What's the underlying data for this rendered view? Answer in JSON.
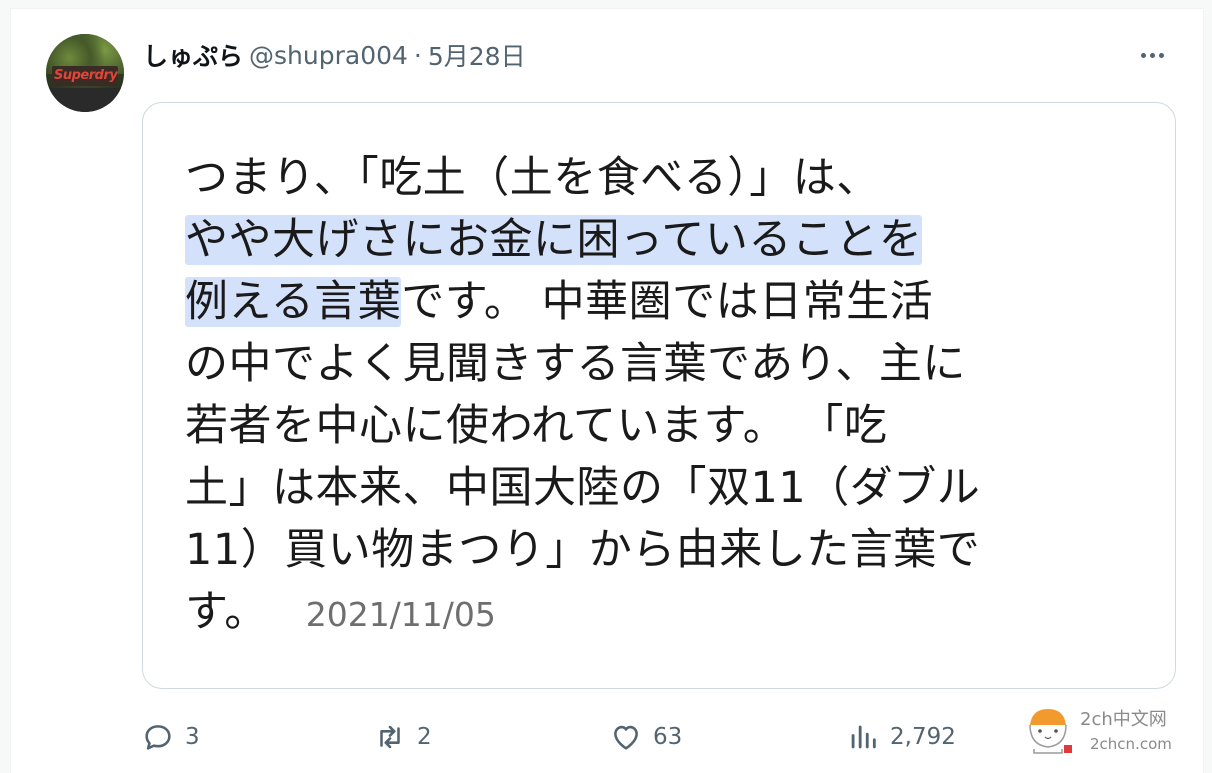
{
  "user": {
    "display_name": "しゅぷら",
    "handle": "@shupra004",
    "separator": "·",
    "date": "5月28日",
    "avatar_text": "Superdry"
  },
  "card": {
    "lines": [
      "つまり、「吃土（土を食べる）」は、",
      "やや大げさにお金に困っていることを",
      "例える言葉",
      "です。 中華圏では日常生活",
      "の中でよく見聞きする言葉であり、主に",
      "若者を中心に使われています。 「吃",
      "土」は本来、中国大陸の「双11（ダブル",
      "11）買い物まつり」から由来した言葉で",
      "す。"
    ],
    "date_stamp": "2021/11/05"
  },
  "actions": {
    "replies": "3",
    "reposts": "2",
    "likes": "63",
    "views": "2,792"
  },
  "watermark": {
    "title": "2ch中文网",
    "url": "2chcn.com"
  },
  "colors": {
    "highlight": "#d4e1fb",
    "secondary_text": "#536471",
    "border": "#cfd9de"
  }
}
